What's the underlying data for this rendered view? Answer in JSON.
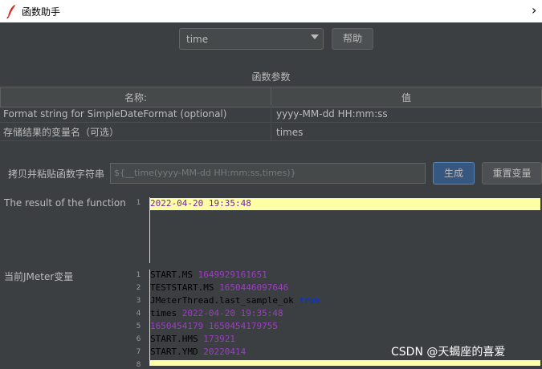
{
  "window": {
    "title": "函数助手",
    "close_glyph": "›"
  },
  "function_select": {
    "value": "time"
  },
  "help_button": "帮助",
  "params_title": "函数参数",
  "table": {
    "headers": {
      "name": "名称:",
      "value": "值"
    },
    "rows": [
      {
        "name": "Format string for SimpleDateFormat (optional)",
        "value": "yyyy-MM-dd HH:mm:ss"
      },
      {
        "name": "存储结果的变量名（可选）",
        "value": "times"
      }
    ]
  },
  "copy_row": {
    "label": "拷贝并粘贴函数字符串",
    "value": "${__time(yyyy-MM-dd HH:mm:ss,times)}",
    "generate_button": "生成",
    "reset_button": "重置变量"
  },
  "result": {
    "label": "The result of the function is",
    "line_numbers": [
      "1"
    ],
    "value": "2022-04-20 19:35:48"
  },
  "variables": {
    "label": "当前JMeter变量",
    "line_numbers": [
      "1",
      "2",
      "3",
      "4",
      "5",
      "6",
      "7",
      "8"
    ],
    "lines": [
      {
        "key": "START.MS",
        "value": "1649929161651"
      },
      {
        "key": "TESTSTART.MS",
        "value": "1650446097646"
      },
      {
        "key": "JMeterThread.last_sample_ok",
        "value": "true"
      },
      {
        "key": "times",
        "value": "2022-04-20 19:35:48"
      },
      {
        "key": "",
        "value": "1650454179 1650454179755"
      },
      {
        "key": "START.HMS",
        "value": "173921"
      },
      {
        "key": "START.YMD",
        "value": "20220414"
      }
    ]
  },
  "watermark": "CSDN @天蝎座的喜爱",
  "colors": {
    "accent": "#365880",
    "highlight": "#ffffa5",
    "value_purple": "#9b3ec4",
    "keyword_blue": "#0b36c4"
  }
}
